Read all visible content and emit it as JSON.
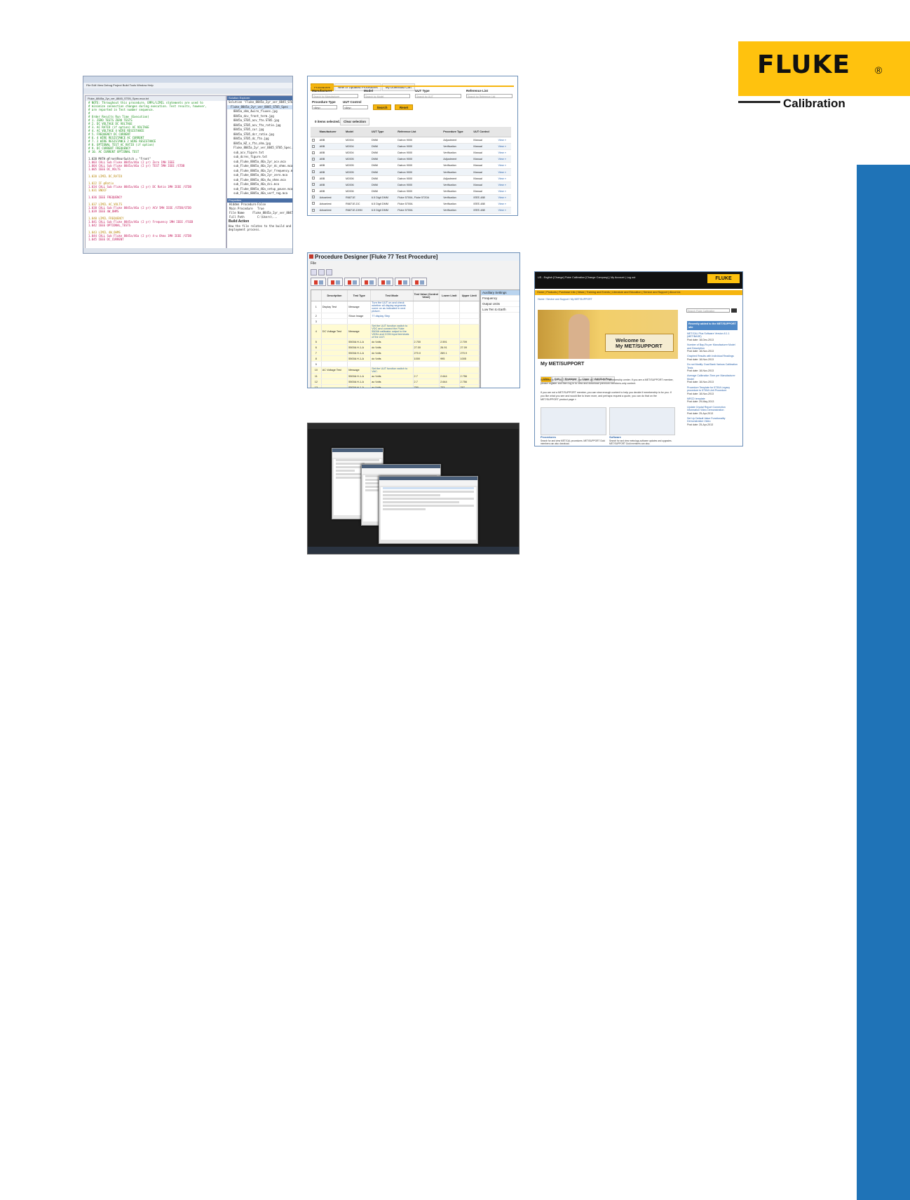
{
  "brand": {
    "name": "FLUKE",
    "registered": "®",
    "division": "Calibration",
    "color": "#FFC20E",
    "sidebar_color": "#1F73B7"
  },
  "vs_editor": {
    "title": "Fluke_8845a_2yr_ver_8845_ST05_Spec.mca - MET/CAL Editor",
    "menu": "File  Edit  View  Debug  Project  Build  Tools  Window  Help",
    "tab": "Fluke_8845a_2yr_ver_8845_ST05_Spec.mca.txt",
    "code_lines": [
      "# NOTE: Throughout this procedure, EMPL/LIMIL statements are used to",
      "# minimize connection changes during execution. Test results, however,",
      "# are reported in Test number sequence.",
      "#",
      "#  Order  Results                    Run Time (Execution)",
      "#  1.     ZERO TESTS                 ZERO TESTS",
      "#  2.     DC VOLTAGE                 DC VOLTAGE",
      "#  3.     AC RATIO (if option)       AC VOLTAGE",
      "#  4.     AC VOLTAGE                 4 WIRE RESISTANCE",
      "#  5.     FREQUENCY                  DC CURRENT",
      "#  6.     4 WIRE RESISTANCE          AC CURRENT",
      "#  7.     2 WIRE RESISTANCE          2 WIRE RESISTANCE",
      "#  8.     OPTIONAL TEST              AC RATIO (if option)",
      "#  9.     DC CURRENT                 FREQUENCY",
      "#  10.    AC CURRENT                 OPTIONAL TEST",
      "",
      "1.020  MATH    @FrontRearSwitch = \"Front\"",
      "1.003  CALL    Sub Fluke 8845a/46a (2 yr) Zero 1MH IEEE",
      "1.004  CALL    Sub Fluke 8845a/46a (2 yr) TEST 5MH IEEE /STDB",
      "1.005  IEEE    DC_VOLTS",
      "",
      "1.020  LIMIL   DC_RATIO",
      "",
      "1.022  IF      @Ratio",
      "1.034  CALL    Sub Fluke 8845a/46a (2 yr) DC Ratio 1MH IEEE /STDB",
      "1.031  ENDIF",
      "",
      "1.036  IEEE    FREQUENCY",
      "",
      "1.037  LIMIL   AC_VOLTS",
      "1.038  CALL    Sub Fluke 8845a/46a (2 yr) ACV 5MH IEEE /STDB/STDD",
      "1.039  IEEE    4W_OHMS",
      "",
      "1.040  LIMIL   FREQUENCY",
      "1.041  CALL    Sub Fluke 8845a/46a (2 yr) Frequency 1MH IEEE /FSEB",
      "1.042  IEEE    OPTIONAL_TESTS",
      "",
      "1.043  LIMIL   4W_OHMS",
      "1.044  CALL    Sub Fluke 8845a/46a (2 yr) 4-w Ohms 1MH IEEE /STDB",
      "1.045  IEEE    DC_CURRENT"
    ],
    "explorer_title": "Solution Explorer",
    "explorer_items": [
      "Solution 'Fluke_8845a_2yr_ver_8845_ST05_Spec'",
      "Fluke_8845a_2yr_ver_8845_ST05_Spec",
      "8845a_ohm_4wire_fluxes.jpg",
      "8845a_dcv_front_term.jpg",
      "8845a_ST05_acv_fto.ST05.jpg",
      "8845a_ST05_acv_fto_ratio.jpg",
      "8845a_ST05_cur.jpg",
      "8845a_ST05_dcr_ratio.jpg",
      "8845a_ST05_dc_fto.jpg",
      "8845a_HZ_s_fto_ohm.jpg",
      "Fluke_8845a_2yr_ver_8845_ST05_Spec.mca",
      "sub_acv_figure.txt",
      "sub_dcres_figure.txt",
      "sub_Fluke_8845a_46a_2yr_acv.mca",
      "sub_Fluke_8845a_46a_2yr_dc_ohms.mca",
      "sub_Fluke_8845a_46a_2yr_frequency.mca",
      "sub_Fluke_8845a_46a_2yr_zero.mca",
      "sub_Fluke_8845a_46a_4w_ohms.mca",
      "sub_Fluke_8845a_46a_dci.mca",
      "sub_Fluke_8845a_46a_setup_pause.mca",
      "sub_Fluke_8845a_46a_verf_reg.mca"
    ],
    "properties_title": "Properties",
    "properties": [
      [
        "Hidden Procedure",
        "False"
      ],
      [
        "Main Procedure",
        "True"
      ],
      [
        "File Name",
        "Fluke_8845a_2yr_ver_8845"
      ],
      [
        "Full Path",
        "C:\\Users\\..."
      ]
    ],
    "build_action_title": "Build Action",
    "build_action_text": "How the file relates to the build and deployment process."
  },
  "procedures_page": {
    "tabs": [
      "Procedures",
      "New or Updated Procedures",
      "My Download Cart"
    ],
    "active_tab": 0,
    "fields": {
      "manufacturer_label": "Manufacturer",
      "manufacturer_placeholder": "Search by Manufacturer",
      "model_label": "Model",
      "model_placeholder": "Search by Model",
      "uut_type_label": "UUT Type",
      "uut_type_placeholder": "Search by UUT",
      "reference_list_label": "Reference List",
      "reference_list_placeholder": "Search by Reference List",
      "procedure_type_label": "Procedure Type",
      "procedure_type_value": "<Any>",
      "uut_control_label": "UUT Control",
      "uut_control_value": "<Any>"
    },
    "search_label": "Search",
    "reset_label": "Reset",
    "selected_text": "0 items selected.",
    "clear_selection_label": "Clear selection",
    "columns": [
      "Manufacturer",
      "Model",
      "UUT Type",
      "Reference List",
      "Procedure Type",
      "UUT Control",
      ""
    ],
    "rows": [
      [
        "ABB",
        "M2004",
        "DMM",
        "Datron 9000",
        "Adjustment",
        "Manual",
        "View »"
      ],
      [
        "ABB",
        "M2004",
        "DMM",
        "Datron 9000",
        "Verification",
        "Manual",
        "View »"
      ],
      [
        "ABB",
        "M2004",
        "DMM",
        "Datron 9000",
        "Verification",
        "Manual",
        "View »"
      ],
      [
        "ABB",
        "M2005",
        "DMM",
        "Datron 9000",
        "Adjustment",
        "Manual",
        "View »"
      ],
      [
        "ABB",
        "M2005",
        "DMM",
        "Datron 9000",
        "Verification",
        "Manual",
        "View »"
      ],
      [
        "ABB",
        "M2005",
        "DMM",
        "Datron 9000",
        "Verification",
        "Manual",
        "View »"
      ],
      [
        "ABB",
        "M2006",
        "DMM",
        "Datron 9000",
        "Adjustment",
        "Manual",
        "View »"
      ],
      [
        "ABB",
        "M2006",
        "DMM",
        "Datron 9000",
        "Verification",
        "Manual",
        "View »"
      ],
      [
        "ABB",
        "M2006",
        "DMM",
        "Datron 9000",
        "Verification",
        "Manual",
        "View »"
      ],
      [
        "Advantest",
        "R6871E",
        "6.5 Digit DMM",
        "Fluke 5700A, Fluke 5720A",
        "Verification",
        "IEEE-488",
        "View »"
      ],
      [
        "Advantest",
        "R6871E-DC",
        "6.5 Digit DMM",
        "Fluke 5700A",
        "Verification",
        "IEEE-488",
        "View »"
      ],
      [
        "Advantest",
        "R6871E-DHM",
        "6.5 Digit DMM",
        "Fluke 5700A",
        "Verification",
        "IEEE-488",
        "View »"
      ]
    ]
  },
  "designer": {
    "title": "Procedure Designer [Fluke 77 Test Procedure]",
    "menu_file": "File",
    "columns": [
      "",
      "Description",
      "Test Type",
      "Test Mode",
      "Test Value (Control Value)",
      "Lower Limit",
      "Upper Limit"
    ],
    "rows": [
      {
        "n": "1",
        "desc": "Display Test",
        "type": "Message",
        "mode": "Turn the UUT on and check whether all display segments come on as indicated in next picture.",
        "val": "",
        "lo": "",
        "hi": "",
        "y": false
      },
      {
        "n": "2",
        "desc": "",
        "type": "Show Image",
        "mode": "77 display Step",
        "val": "",
        "lo": "",
        "hi": "",
        "y": false
      },
      {
        "n": "3",
        "desc": "",
        "type": "",
        "mode": "",
        "val": "",
        "lo": "",
        "hi": "",
        "y": false
      },
      {
        "n": "4",
        "desc": "DC Voltage Test",
        "type": "Message",
        "mode": "Set the UUT function switch to VDC and connect the Fluke 5500A calibrator output to the VΩHz and COM input terminals of the UUT.",
        "val": "",
        "lo": "",
        "hi": "",
        "y": true
      },
      {
        "n": "5",
        "desc": "",
        "type": "5500A H-1-A",
        "mode": "dc Volts",
        "val": "2.700",
        "lo": "2.591",
        "hi": "2.709",
        "y": true
      },
      {
        "n": "6",
        "desc": "",
        "type": "5500A H-1-A",
        "mode": "dc Volts",
        "val": "27.00",
        "lo": "26.91",
        "hi": "27.09",
        "y": true
      },
      {
        "n": "7",
        "desc": "",
        "type": "5500A H-1-A",
        "mode": "dc Volts",
        "val": "270.0",
        "lo": "269.1",
        "hi": "270.9",
        "y": true
      },
      {
        "n": "8",
        "desc": "",
        "type": "5500A H-1-A",
        "mode": "dc Volts",
        "val": "1000",
        "lo": "995",
        "hi": "1005",
        "y": true
      },
      {
        "n": "9",
        "desc": "",
        "type": "",
        "mode": "",
        "val": "",
        "lo": "",
        "hi": "",
        "y": false
      },
      {
        "n": "10",
        "desc": "AC Voltage Test",
        "type": "Message",
        "mode": "Set the UUT function switch to VAC.",
        "val": "",
        "lo": "",
        "hi": "",
        "y": true
      },
      {
        "n": "11",
        "desc": "",
        "type": "5500A H-1-A",
        "mode": "ac Volts",
        "val": "2.7",
        "lo": "2.644",
        "hi": "2.756",
        "y": true
      },
      {
        "n": "12",
        "desc": "",
        "type": "5500A H-1-A",
        "mode": "ac Volts",
        "val": "2.7",
        "lo": "2.644",
        "hi": "2.756",
        "y": true
      },
      {
        "n": "13",
        "desc": "",
        "type": "5500A H-1-A",
        "mode": "ac Volts",
        "val": "750",
        "lo": "733",
        "hi": "767",
        "y": true
      },
      {
        "n": "▶ 14",
        "desc": "",
        "type": "5500A H-1-A",
        "mode": "ac Volts",
        "val": "750",
        "lo": "733",
        "hi": "767",
        "y": true
      },
      {
        "n": "15",
        "desc": "",
        "type": "",
        "mode": "",
        "val": "",
        "lo": "",
        "hi": "",
        "y": false
      }
    ],
    "side_items": [
      "Auxiliary Settings",
      "Frequency",
      "Output Units",
      "Low Ten to Earth"
    ],
    "side_selected": 0
  },
  "met_support": {
    "top_links": "US - English [Change]   Fluke Calibration [Change Company]   |   My Account   |   Log out",
    "logo": "FLUKE",
    "logo_sub": "Calibration",
    "nav": "Home  |  Products  |  Purchase Info  |  News  |  Training and Events  |  Literature and Education  |  Service and Support  |  About Us",
    "breadcrumb": "Home / Service and Support / My MET/SUPPORT",
    "hero_text_1": "Welcome to",
    "hero_text_2": "My MET/SUPPORT",
    "title": "My MET/SUPPORT",
    "subtabs": [
      "View",
      "Edit",
      "Revisions",
      "Clone",
      "Add Sub Page"
    ],
    "active_subtab": 0,
    "para1": "Welcome to MY MET/SUPPORT, the online MET/SUPPORT membership center. If you are a MET/SUPPORT member, please register and then log in to view and download premium members-only content.",
    "para2": "If you are not a MET/SUPPORT member, you can view enough content to help you decide if membership is for you. If you like what you see and would like to learn more, and perhaps request a quote, you can do that on the MET/SUPPORT product page »",
    "thumb1_caption": "Procedures",
    "thumb1_text": "Search for and view MET/CAL procedures. MET/SUPPORT Gold members can also download.",
    "thumb2_caption": "Software",
    "thumb2_text": "Search for and view metrology software updates and upgrades. MET/SUPPORT Gold members can also.",
    "search_placeholder": "Search Fluke Calibration",
    "news_header": "Recently added to the MET/SUPPORT site",
    "news": [
      {
        "title": "MET/CAL Plus Software Version 8.1.1 (MET/BASE)",
        "date": "Post date: 18-Dec-2013"
      },
      {
        "title": "Number of Bay-Rs per Manufacturer Model and Description",
        "date": "Post date: 18-Nov-2013"
      },
      {
        "title": "Graphed Results with Individual Readings",
        "date": "Post date: 18-Nov-2013"
      },
      {
        "title": "Do not Modify: Dual Bank Various Calibration Tests",
        "date": "Post date: 18-Nov-2013"
      },
      {
        "title": "Average Calibration Time per Manufacturer Model",
        "date": "Post date: 18-Nov-2013"
      },
      {
        "title": "Procedure Template for 5730A Legacy procedure to 5730A Unit Procedure",
        "date": "Post date: 18-Nov-2013"
      },
      {
        "title": "MRCD template",
        "date": "Post date: 29-May-2013"
      },
      {
        "title": "Update Crystal Report Connection Information Video Demonstration",
        "date": "Post date: 25-Apr-2013"
      },
      {
        "title": "Set Up Default Value Functionality Demonstration Video",
        "date": "Post date: 25-Apr-2013"
      }
    ]
  }
}
